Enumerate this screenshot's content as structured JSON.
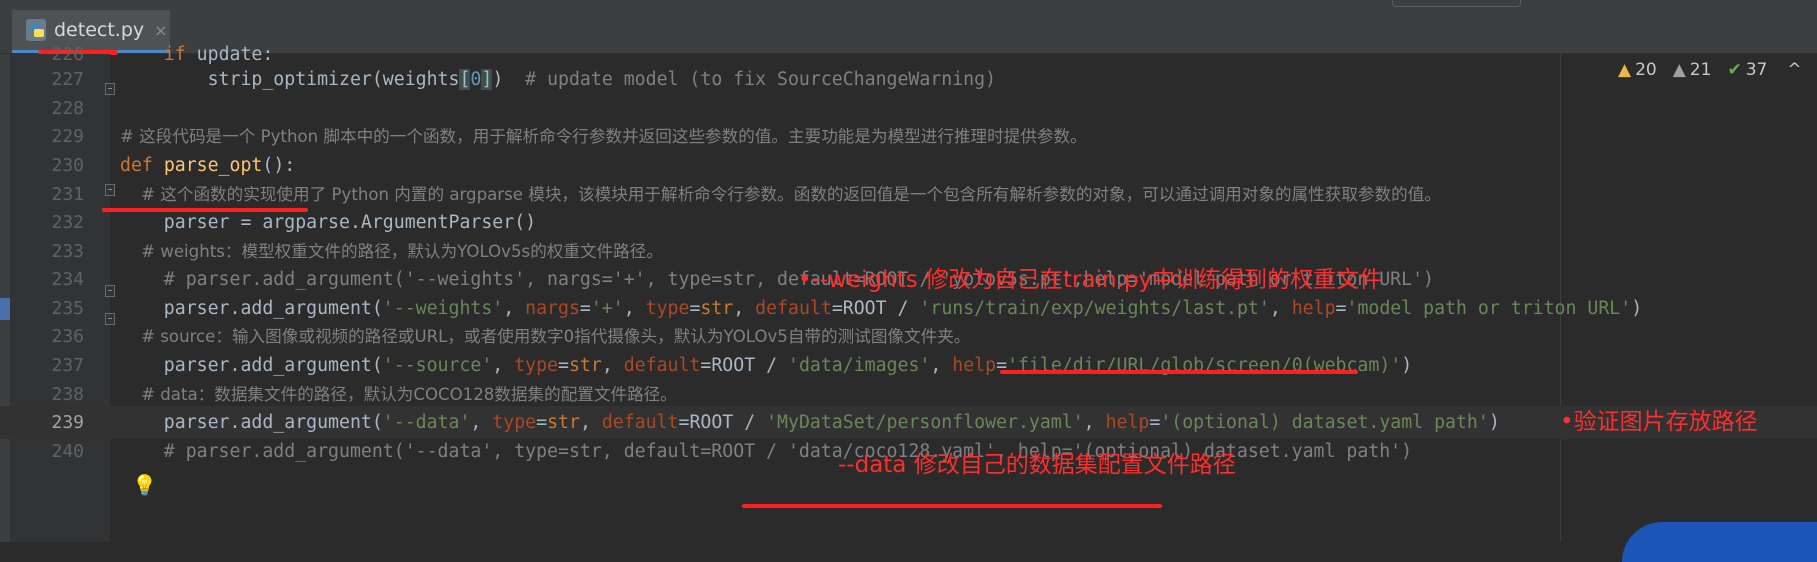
{
  "tab": {
    "filename": "detect.py",
    "close": "×"
  },
  "inspections": {
    "warnings": "20",
    "weak_warnings": "21",
    "typos": "37",
    "warn_glyph": "▲",
    "ok_glyph": "✔",
    "collapse_glyph": "^"
  },
  "lines": [
    {
      "num": "226",
      "code": "    if update:"
    },
    {
      "num": "227",
      "code": "        strip_optimizer(weights[0])  # update model (to fix SourceChangeWarning)"
    },
    {
      "num": "228",
      "code": ""
    },
    {
      "num": "229",
      "code": "# 这段代码是一个 Python 脚本中的一个函数，用于解析命令行参数并返回这些参数的值。主要功能是为模型进行推理时提供参数。"
    },
    {
      "num": "230",
      "code": "def parse_opt():"
    },
    {
      "num": "231",
      "code": "    # 这个函数的实现使用了 Python 内置的 argparse 模块，该模块用于解析命令行参数。函数的返回值是一个包含所有解析参数的对象，可以通过调用对象的属性获取参数的值。"
    },
    {
      "num": "232",
      "code": "    parser = argparse.ArgumentParser()"
    },
    {
      "num": "233",
      "code": "    # weights：模型权重文件的路径，默认为YOLOv5s的权重文件路径。"
    },
    {
      "num": "234",
      "code": "    # parser.add_argument('--weights', nargs='+', type=str, default=ROOT / 'yolov5s.pt',help='model path or triton URL')"
    },
    {
      "num": "235",
      "code": "    parser.add_argument('--weights', nargs='+', type=str, default=ROOT / 'runs/train/exp/weights/last.pt', help='model path or triton URL')"
    },
    {
      "num": "236",
      "code": "    # source：输入图像或视频的路径或URL，或者使用数字0指代摄像头，默认为YOLOv5自带的测试图像文件夹。"
    },
    {
      "num": "237",
      "code": "    parser.add_argument('--source', type=str, default=ROOT / 'data/images', help='file/dir/URL/glob/screen/0(webcam)')"
    },
    {
      "num": "238",
      "code": "    # data：数据集文件的路径，默认为COCO128数据集的配置文件路径。"
    },
    {
      "num": "239",
      "code": "    parser.add_argument('--data', type=str, default=ROOT / 'MyDataSet/personflower.yaml', help='(optional) dataset.yaml path')"
    },
    {
      "num": "240",
      "code": "    # parser.add_argument('--data', type=str, default=ROOT / 'data/coco128.yaml', help='(optional) dataset.yaml path')"
    }
  ],
  "annotations": {
    "weights_note": "•--weights  修改为自己在train.py中训练得到的权重文件",
    "source_note": "•验证图片存放路径",
    "data_note": "--data  修改自己的数据集配置文件路径"
  },
  "colors": {
    "annotation": "#ff2d2d",
    "editor_bg": "#2b2b2b",
    "keyword": "#cc7832",
    "string": "#6a8759",
    "comment": "#808080"
  }
}
